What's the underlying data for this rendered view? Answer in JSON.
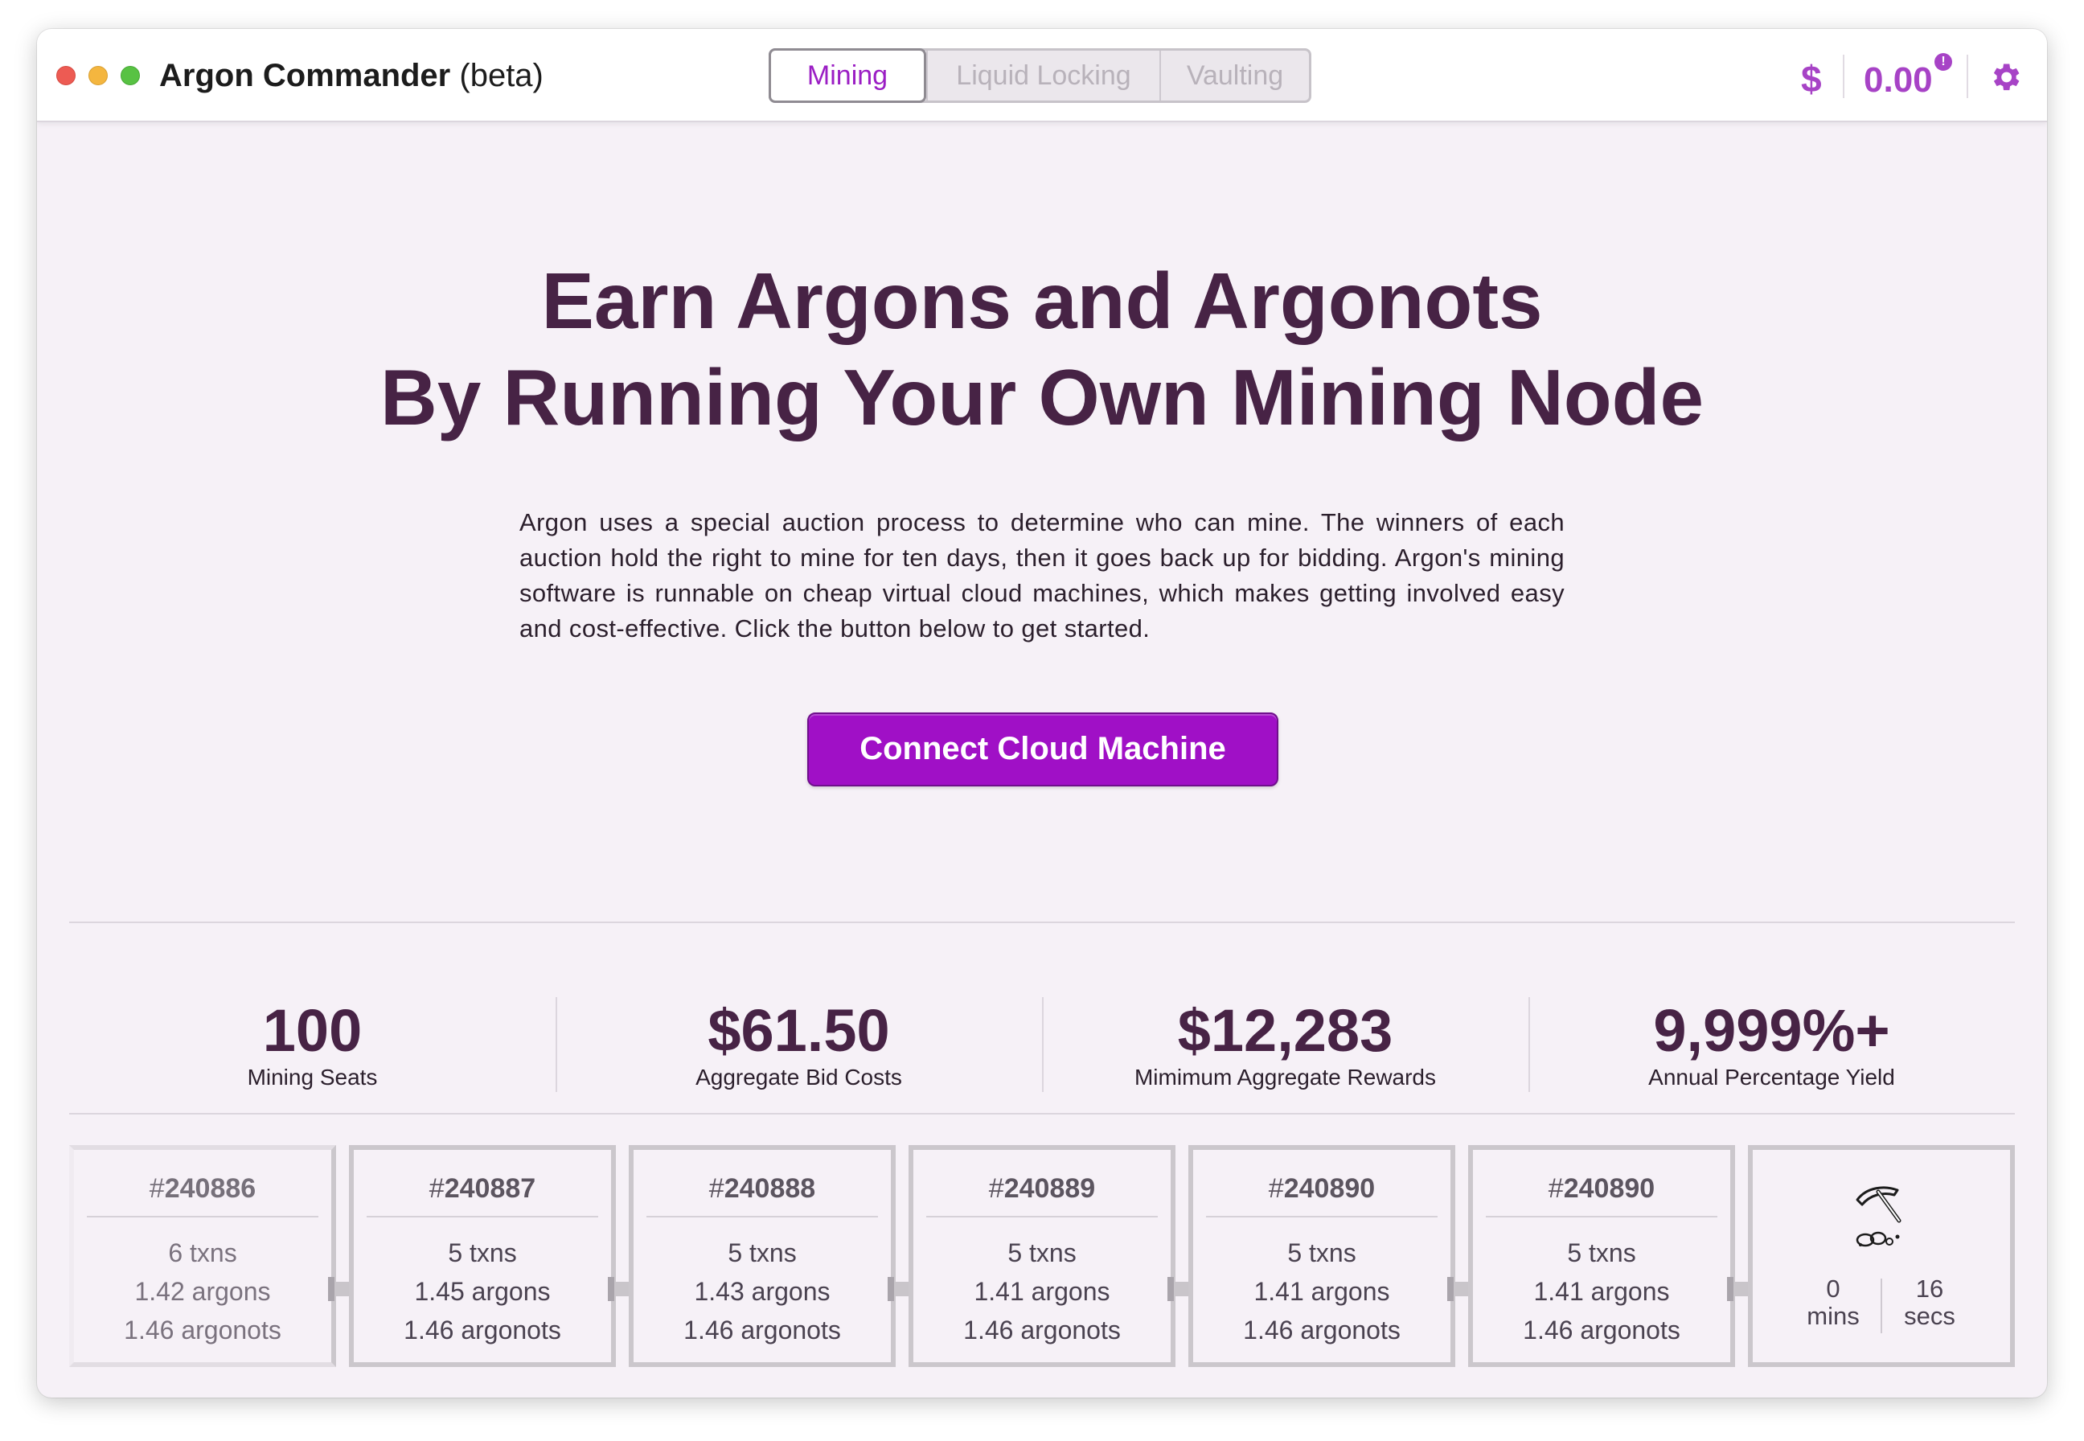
{
  "window": {
    "title": "Argon Commander",
    "title_suffix": "(beta)"
  },
  "tabs": [
    {
      "label": "Mining",
      "active": true
    },
    {
      "label": "Liquid Locking",
      "active": false
    },
    {
      "label": "Vaulting",
      "active": false
    }
  ],
  "toolbar": {
    "currency_symbol": "$",
    "balance": "0.00",
    "alert_badge": "!",
    "settings_icon": "gear-icon",
    "accent_color": "#a743c6"
  },
  "hero": {
    "title_line1": "Earn Argons and Argonots",
    "title_line2": "By Running Your Own Mining Node",
    "description": "Argon uses a special auction process to determine who can mine. The winners of each auction hold the right to mine for ten days, then it goes back up for bidding. Argon's mining software is runnable on cheap virtual cloud machines, which makes getting involved easy and cost-effective. Click the button below to get started.",
    "cta_label": "Connect Cloud Machine",
    "cta_color": "#a010c6"
  },
  "stats": [
    {
      "value": "100",
      "label": "Mining Seats"
    },
    {
      "value": "$61.50",
      "label": "Aggregate Bid Costs"
    },
    {
      "value": "$12,283",
      "label": "Mimimum Aggregate Rewards"
    },
    {
      "value": "9,999%+",
      "label": "Annual Percentage Yield"
    }
  ],
  "blocks": [
    {
      "number": "240886",
      "txns": "6 txns",
      "argons": "1.42 argons",
      "argonots": "1.46 argonots"
    },
    {
      "number": "240887",
      "txns": "5 txns",
      "argons": "1.45 argons",
      "argonots": "1.46 argonots"
    },
    {
      "number": "240888",
      "txns": "5 txns",
      "argons": "1.43 argons",
      "argonots": "1.46 argonots"
    },
    {
      "number": "240889",
      "txns": "5 txns",
      "argons": "1.41 argons",
      "argonots": "1.46 argonots"
    },
    {
      "number": "240890",
      "txns": "5 txns",
      "argons": "1.41 argons",
      "argonots": "1.46 argonots"
    },
    {
      "number": "240890",
      "txns": "5 txns",
      "argons": "1.41 argons",
      "argonots": "1.46 argonots"
    }
  ],
  "next_block": {
    "icon": "pickaxe-icon",
    "mins_value": "0",
    "mins_label": "mins",
    "secs_value": "16",
    "secs_label": "secs"
  }
}
